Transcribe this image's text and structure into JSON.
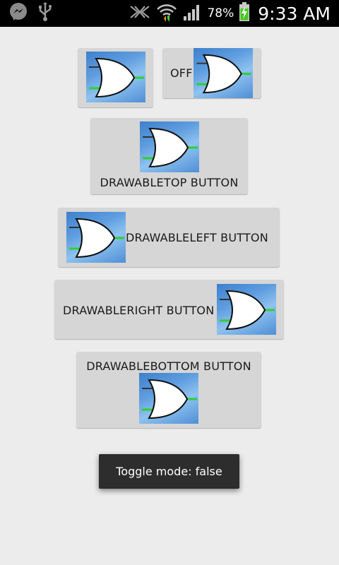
{
  "status_bar": {
    "icons": [
      "messenger-icon",
      "usb-icon",
      "nfc-icon",
      "wifi-icon",
      "signal-icon",
      "battery-charging-icon"
    ],
    "battery_percent": "78%",
    "time": "9:33 AM"
  },
  "buttons": {
    "image_button": {
      "icon": "or-gate-icon"
    },
    "toggle_button": {
      "label": "OFF",
      "icon": "or-gate-icon"
    },
    "drawable_top": {
      "label": "DRAWABLETOP BUTTON",
      "icon": "or-gate-icon"
    },
    "drawable_left": {
      "label": "DRAWABLELEFT BUTTON",
      "icon": "or-gate-icon"
    },
    "drawable_right": {
      "label": "DRAWABLERIGHT BUTTON",
      "icon": "or-gate-icon"
    },
    "drawable_bottom": {
      "label": "DRAWABLEBOTTOM BUTTON",
      "icon": "or-gate-icon"
    }
  },
  "toast": {
    "text": "Toggle mode: false"
  },
  "colors": {
    "background": "#ececec",
    "button_bg": "#d6d6d6",
    "toast_bg": "#2d2d2d",
    "gate_wire_green": "#2ed02e",
    "gate_wire_dark": "#333333"
  }
}
